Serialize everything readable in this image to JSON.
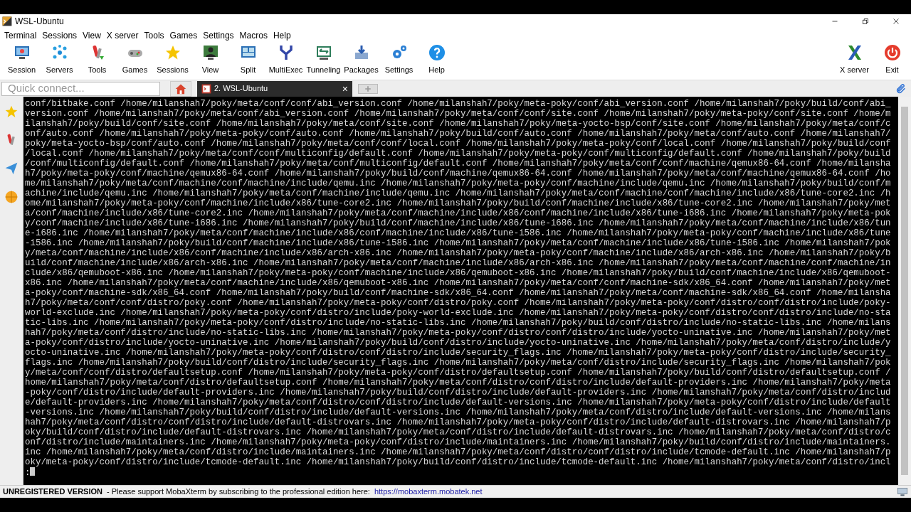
{
  "window": {
    "title": "WSL-Ubuntu"
  },
  "menu": [
    "Terminal",
    "Sessions",
    "View",
    "X server",
    "Tools",
    "Games",
    "Settings",
    "Macros",
    "Help"
  ],
  "toolbar": [
    {
      "label": "Session",
      "kind": "monitor"
    },
    {
      "label": "Servers",
      "kind": "network"
    },
    {
      "label": "Tools",
      "kind": "tools"
    },
    {
      "label": "Games",
      "kind": "gamepad"
    },
    {
      "label": "Sessions",
      "kind": "star"
    },
    {
      "label": "View",
      "kind": "user"
    },
    {
      "label": "Split",
      "kind": "split"
    },
    {
      "label": "MultiExec",
      "kind": "fork"
    },
    {
      "label": "Tunneling",
      "kind": "tunnel"
    },
    {
      "label": "Packages",
      "kind": "package"
    },
    {
      "label": "Settings",
      "kind": "gears"
    },
    {
      "label": "Help",
      "kind": "help"
    }
  ],
  "toolbar_right": [
    {
      "label": "X server",
      "kind": "xlogo"
    },
    {
      "label": "Exit",
      "kind": "power"
    }
  ],
  "quick_connect": {
    "placeholder": "Quick connect..."
  },
  "tabs": [
    {
      "label": "2. WSL-Ubuntu",
      "selected": true,
      "close": "×"
    }
  ],
  "terminal": {
    "lines": [
      "conf/bitbake.conf /home/milanshah7/poky/meta/conf/conf/abi_version.conf /home/milanshah7/poky/meta-poky/conf/abi_version.conf /home/milanshah7/poky/build/conf/abi_",
      "version.conf /home/milanshah7/poky/meta/conf/abi_version.conf /home/milanshah7/poky/meta/conf/conf/site.conf /home/milanshah7/poky/meta-poky/conf/site.conf /home/m",
      "ilanshah7/poky/build/conf/site.conf /home/milanshah7/poky/meta/conf/site.conf /home/milanshah7/poky/meta-yocto-bsp/conf/site.conf /home/milanshah7/poky/meta/conf/c",
      "onf/auto.conf /home/milanshah7/poky/meta-poky/conf/auto.conf /home/milanshah7/poky/build/conf/auto.conf /home/milanshah7/poky/meta/conf/auto.conf /home/milanshah7/",
      "poky/meta-yocto-bsp/conf/auto.conf /home/milanshah7/poky/meta/conf/conf/local.conf /home/milanshah7/poky/meta-poky/conf/local.conf /home/milanshah7/poky/build/conf",
      "/local.conf /home/milanshah7/poky/meta/conf/conf/multiconfig/default.conf /home/milanshah7/poky/meta-poky/conf/multiconfig/default.conf /home/milanshah7/poky/build",
      "/conf/multiconfig/default.conf /home/milanshah7/poky/meta/conf/multiconfig/default.conf /home/milanshah7/poky/meta/conf/conf/machine/qemux86-64.conf /home/milansha",
      "h7/poky/meta-poky/conf/machine/qemux86-64.conf /home/milanshah7/poky/build/conf/machine/qemux86-64.conf /home/milanshah7/poky/meta/conf/machine/qemux86-64.conf /ho",
      "me/milanshah7/poky/meta/conf/machine/conf/machine/include/qemu.inc /home/milanshah7/poky/meta-poky/conf/machine/include/qemu.inc /home/milanshah7/poky/build/conf/m",
      "achine/include/qemu.inc /home/milanshah7/poky/meta/conf/machine/include/qemu.inc /home/milanshah7/poky/meta/conf/machine/conf/machine/include/x86/tune-core2.inc /h",
      "ome/milanshah7/poky/meta-poky/conf/machine/include/x86/tune-core2.inc /home/milanshah7/poky/build/conf/machine/include/x86/tune-core2.inc /home/milanshah7/poky/met",
      "a/conf/machine/include/x86/tune-core2.inc /home/milanshah7/poky/meta/conf/machine/include/x86/conf/machine/include/x86/tune-i686.inc /home/milanshah7/poky/meta-pok",
      "y/conf/machine/include/x86/tune-i686.inc /home/milanshah7/poky/build/conf/machine/include/x86/tune-i686.inc /home/milanshah7/poky/meta/conf/machine/include/x86/tun",
      "e-i686.inc /home/milanshah7/poky/meta/conf/machine/include/x86/conf/machine/include/x86/tune-i586.inc /home/milanshah7/poky/meta-poky/conf/machine/include/x86/tune",
      "-i586.inc /home/milanshah7/poky/build/conf/machine/include/x86/tune-i586.inc /home/milanshah7/poky/meta/conf/machine/include/x86/tune-i586.inc /home/milanshah7/pok",
      "y/meta/conf/machine/include/x86/conf/machine/include/x86/arch-x86.inc /home/milanshah7/poky/meta-poky/conf/machine/include/x86/arch-x86.inc /home/milanshah7/poky/b",
      "uild/conf/machine/include/x86/arch-x86.inc /home/milanshah7/poky/meta/conf/machine/include/x86/arch-x86.inc /home/milanshah7/poky/meta/conf/machine/conf/machine/in",
      "clude/x86/qemuboot-x86.inc /home/milanshah7/poky/meta-poky/conf/machine/include/x86/qemuboot-x86.inc /home/milanshah7/poky/build/conf/machine/include/x86/qemuboot-",
      "x86.inc /home/milanshah7/poky/meta/conf/machine/include/x86/qemuboot-x86.inc /home/milanshah7/poky/meta/conf/conf/machine-sdk/x86_64.conf /home/milanshah7/poky/met",
      "a-poky/conf/machine-sdk/x86_64.conf /home/milanshah7/poky/build/conf/machine-sdk/x86_64.conf /home/milanshah7/poky/meta/conf/machine-sdk/x86_64.conf /home/milansha",
      "h7/poky/meta/conf/conf/distro/poky.conf /home/milanshah7/poky/meta-poky/conf/distro/poky.conf /home/milanshah7/poky/meta-poky/conf/distro/conf/distro/include/poky-",
      "world-exclude.inc /home/milanshah7/poky/meta-poky/conf/distro/include/poky-world-exclude.inc /home/milanshah7/poky/meta-poky/conf/distro/conf/distro/include/no-sta",
      "tic-libs.inc /home/milanshah7/poky/meta-poky/conf/distro/include/no-static-libs.inc /home/milanshah7/poky/build/conf/distro/include/no-static-libs.inc /home/milans",
      "hah7/poky/meta/conf/distro/include/no-static-libs.inc /home/milanshah7/poky/meta-poky/conf/distro/conf/distro/include/yocto-uninative.inc /home/milanshah7/poky/met",
      "a-poky/conf/distro/include/yocto-uninative.inc /home/milanshah7/poky/build/conf/distro/include/yocto-uninative.inc /home/milanshah7/poky/meta/conf/distro/include/y",
      "octo-uninative.inc /home/milanshah7/poky/meta-poky/conf/distro/conf/distro/include/security_flags.inc /home/milanshah7/poky/meta-poky/conf/distro/include/security_",
      "flags.inc /home/milanshah7/poky/build/conf/distro/include/security_flags.inc /home/milanshah7/poky/meta/conf/distro/include/security_flags.inc /home/milanshah7/pok",
      "y/meta/conf/conf/distro/defaultsetup.conf /home/milanshah7/poky/meta-poky/conf/distro/defaultsetup.conf /home/milanshah7/poky/build/conf/distro/defaultsetup.conf /",
      "home/milanshah7/poky/meta/conf/distro/defaultsetup.conf /home/milanshah7/poky/meta/conf/distro/conf/distro/include/default-providers.inc /home/milanshah7/poky/meta",
      "-poky/conf/distro/include/default-providers.inc /home/milanshah7/poky/build/conf/distro/include/default-providers.inc /home/milanshah7/poky/meta/conf/distro/includ",
      "e/default-providers.inc /home/milanshah7/poky/meta/conf/distro/conf/distro/include/default-versions.inc /home/milanshah7/poky/meta-poky/conf/distro/include/default",
      "-versions.inc /home/milanshah7/poky/build/conf/distro/include/default-versions.inc /home/milanshah7/poky/meta/conf/distro/include/default-versions.inc /home/milans",
      "hah7/poky/meta/conf/distro/conf/distro/include/default-distrovars.inc /home/milanshah7/poky/meta-poky/conf/distro/include/default-distrovars.inc /home/milanshah7/p",
      "oky/build/conf/distro/include/default-distrovars.inc /home/milanshah7/poky/meta/conf/distro/include/default-distrovars.inc /home/milanshah7/poky/meta/conf/distro/c",
      "onf/distro/include/maintainers.inc /home/milanshah7/poky/meta-poky/conf/distro/include/maintainers.inc /home/milanshah7/poky/build/conf/distro/include/maintainers.",
      "inc /home/milanshah7/poky/meta/conf/distro/include/maintainers.inc /home/milanshah7/poky/meta/conf/distro/conf/distro/include/tcmode-default.inc /home/milanshah7/p",
      "oky/meta-poky/conf/distro/include/tcmode-default.inc /home/milanshah7/poky/build/conf/distro/include/tcmode-default.inc /home/milanshah7/poky/meta/conf/distro/incl",
      ":"
    ]
  },
  "status_bar": {
    "label": "UNREGISTERED VERSION",
    "message": "-  Please support MobaXterm by subscribing to the professional edition here:",
    "link": "https://mobaxterm.mobatek.net"
  }
}
